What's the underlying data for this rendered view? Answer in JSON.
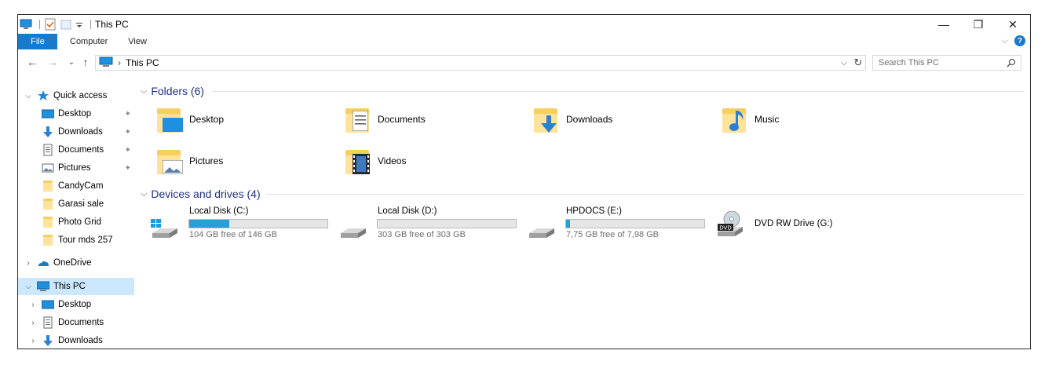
{
  "window": {
    "title": "This PC",
    "controls": {
      "minimize": "—",
      "maximize": "❐",
      "close": "✕"
    }
  },
  "ribbon": {
    "file": "File",
    "tabs": [
      "Computer",
      "View"
    ],
    "expand": "⌵",
    "help": "?"
  },
  "address": {
    "path_root": "This PC",
    "path_separator": "›",
    "dropdown": "⌵",
    "refresh": "↻"
  },
  "search": {
    "placeholder": "Search This PC"
  },
  "nav": {
    "back": "←",
    "forward": "→",
    "recent": "⌄",
    "up": "↑"
  },
  "sidebar": {
    "quick_access": "Quick access",
    "quick_items": [
      {
        "label": "Desktop",
        "icon": "desktop-icon",
        "pinned": true
      },
      {
        "label": "Downloads",
        "icon": "downloads-icon",
        "pinned": true
      },
      {
        "label": "Documents",
        "icon": "documents-icon",
        "pinned": true
      },
      {
        "label": "Pictures",
        "icon": "pictures-icon",
        "pinned": true
      },
      {
        "label": "CandyCam",
        "icon": "folder-icon",
        "pinned": false
      },
      {
        "label": "Garasi sale",
        "icon": "folder-icon",
        "pinned": false
      },
      {
        "label": "Photo Grid",
        "icon": "folder-icon",
        "pinned": false
      },
      {
        "label": "Tour mds 257",
        "icon": "folder-icon",
        "pinned": false
      }
    ],
    "onedrive": "OneDrive",
    "this_pc": "This PC",
    "this_pc_items": [
      {
        "label": "Desktop",
        "icon": "desktop-icon"
      },
      {
        "label": "Documents",
        "icon": "documents-icon"
      },
      {
        "label": "Downloads",
        "icon": "downloads-icon"
      }
    ]
  },
  "content": {
    "folders_heading": "Folders (6)",
    "folders": [
      {
        "label": "Desktop",
        "icon": "desktop-folder-icon"
      },
      {
        "label": "Documents",
        "icon": "documents-folder-icon"
      },
      {
        "label": "Downloads",
        "icon": "downloads-folder-icon"
      },
      {
        "label": "Music",
        "icon": "music-folder-icon"
      },
      {
        "label": "Pictures",
        "icon": "pictures-folder-icon"
      },
      {
        "label": "Videos",
        "icon": "videos-folder-icon"
      }
    ],
    "devices_heading": "Devices and drives (4)",
    "drives": [
      {
        "label": "Local Disk (C:)",
        "free": "104 GB free of 146 GB",
        "used_fraction": 0.288,
        "icon": "system-drive-icon"
      },
      {
        "label": "Local Disk (D:)",
        "free": "303 GB free of 303 GB",
        "used_fraction": 0.0,
        "icon": "drive-icon"
      },
      {
        "label": "HPDOCS (E:)",
        "free": "7,75 GB free of 7,98 GB",
        "used_fraction": 0.029,
        "icon": "drive-icon"
      },
      {
        "label": "DVD RW Drive (G:)",
        "free": "",
        "used_fraction": null,
        "icon": "dvd-drive-icon"
      }
    ]
  },
  "colors": {
    "accent": "#1979ca",
    "selection": "#cce8ff",
    "group_heading": "#1e3287",
    "drive_fill": "#26a0da",
    "folder": "#f7cf5f"
  }
}
